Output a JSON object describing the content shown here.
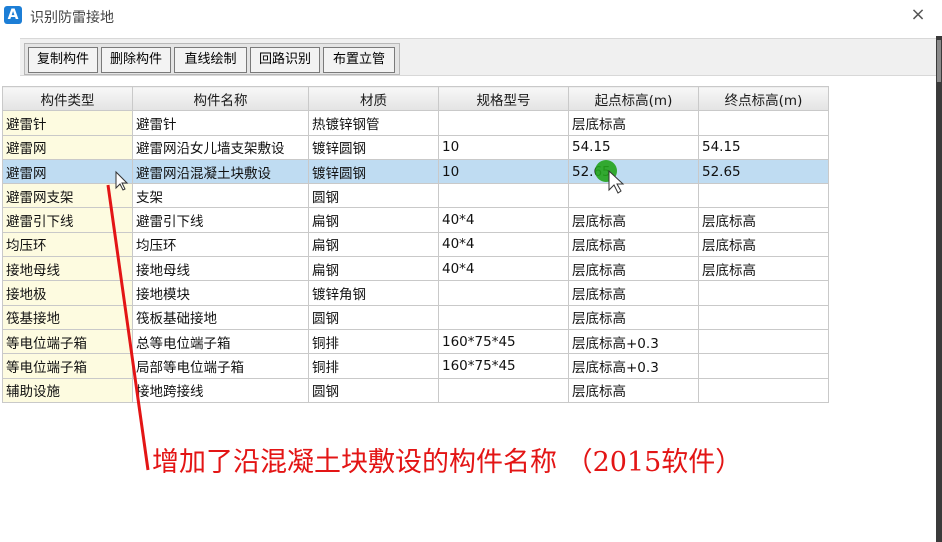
{
  "window": {
    "title": "识别防雷接地",
    "logo_letter": "A",
    "close_glyph": "×"
  },
  "toolbar": {
    "buttons": [
      {
        "label": "复制构件"
      },
      {
        "label": "删除构件"
      },
      {
        "label": "直线绘制"
      },
      {
        "label": "回路识别"
      },
      {
        "label": "布置立管"
      }
    ]
  },
  "grid": {
    "columns": [
      "构件类型",
      "构件名称",
      "材质",
      "规格型号",
      "起点标高(m)",
      "终点标高(m)"
    ],
    "selected_row_index": 2,
    "rows": [
      [
        "避雷针",
        "避雷针",
        "热镀锌钢管",
        "",
        "层底标高",
        ""
      ],
      [
        "避雷网",
        "避雷网沿女儿墙支架敷设",
        "镀锌圆钢",
        "10",
        "54.15",
        "54.15"
      ],
      [
        "避雷网",
        "避雷网沿混凝土块敷设",
        "镀锌圆钢",
        "10",
        "52.65",
        "52.65"
      ],
      [
        "避雷网支架",
        "支架",
        "圆钢",
        "",
        "",
        ""
      ],
      [
        "避雷引下线",
        "避雷引下线",
        "扁钢",
        "40*4",
        "层底标高",
        "层底标高"
      ],
      [
        "均压环",
        "均压环",
        "扁钢",
        "40*4",
        "层底标高",
        "层底标高"
      ],
      [
        "接地母线",
        "接地母线",
        "扁钢",
        "40*4",
        "层底标高",
        "层底标高"
      ],
      [
        "接地极",
        "接地模块",
        "镀锌角钢",
        "",
        "层底标高",
        ""
      ],
      [
        "筏基接地",
        "筏板基础接地",
        "圆钢",
        "",
        "层底标高",
        ""
      ],
      [
        "等电位端子箱",
        "总等电位端子箱",
        "铜排",
        "160*75*45",
        "层底标高+0.3",
        ""
      ],
      [
        "等电位端子箱",
        "局部等电位端子箱",
        "铜排",
        "160*75*45",
        "层底标高+0.3",
        ""
      ],
      [
        "辅助设施",
        "接地跨接线",
        "圆钢",
        "",
        "层底标高",
        ""
      ]
    ]
  },
  "annotation": {
    "text": "增加了沿混凝土块敷设的构件名称 （2015软件）",
    "color": "#e31515"
  },
  "colors": {
    "selected_row": "#bfdcf2",
    "type_column": "#fdfbe0",
    "logo_blue": "#1c7ed6",
    "cursor_highlight": "#22a31c"
  }
}
